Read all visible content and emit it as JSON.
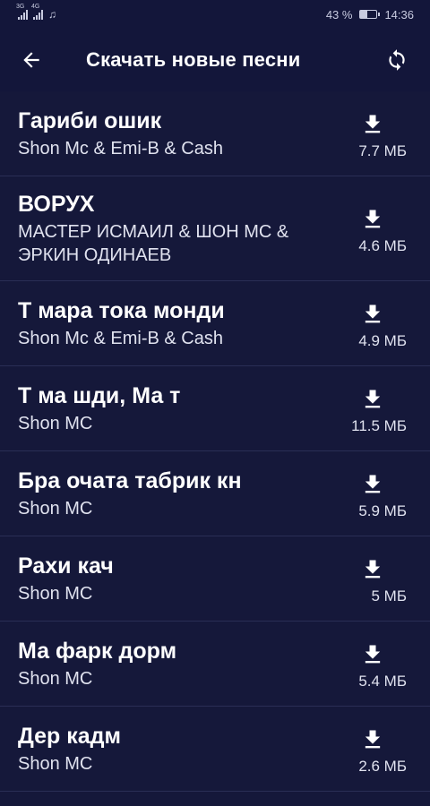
{
  "status": {
    "sig1_label": "3G",
    "sig2_label": "4G",
    "battery_percent": "43 %",
    "battery_level": 0.43,
    "time": "14:36"
  },
  "appbar": {
    "title": "Скачать новые песни",
    "back_icon": "arrow-left-icon",
    "refresh_icon": "refresh-icon"
  },
  "songs": [
    {
      "title": "Гариби ошик",
      "artist": "Shon Mc & Emi-B & Cash",
      "size": "7.7 МБ"
    },
    {
      "title": "ВОРУХ",
      "artist": "МАСТЕР ИСМАИЛ & ШОН МС & ЭРКИН ОДИНАЕВ",
      "size": "4.6 МБ"
    },
    {
      "title": "Т мара тока монди",
      "artist": "Shon Mc & Emi-B & Cash",
      "size": "4.9 МБ"
    },
    {
      "title": "Т ма шди, Ма т",
      "artist": "Shon MC",
      "size": "11.5 МБ"
    },
    {
      "title": "Бра очата табрик кн",
      "artist": "Shon MC",
      "size": "5.9 МБ"
    },
    {
      "title": "Рахи кач",
      "artist": "Shon MC",
      "size": "5 МБ"
    },
    {
      "title": "Ма фарк дорм",
      "artist": "Shon MC",
      "size": "5.4 МБ"
    },
    {
      "title": "Дер кадм",
      "artist": "Shon MC",
      "size": "2.6 МБ"
    }
  ],
  "colors": {
    "background": "#15183a",
    "divider": "#2a2e55",
    "text": "#ffffff"
  }
}
